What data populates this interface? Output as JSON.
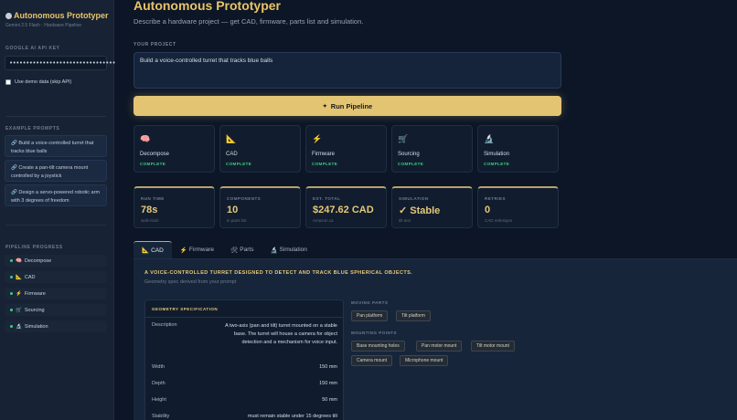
{
  "app": {
    "title": "Autonomous Prototyper",
    "subtitle": "Gemini 2.5 Flash · Hardware Pipeline"
  },
  "sidebar": {
    "api_key_label": "GOOGLE AI API KEY",
    "api_key_value": "••••••••••••••••••••••••••••••••",
    "demo_label": "Use demo data (skip API)",
    "examples_label": "EXAMPLE PROMPTS",
    "examples": [
      "🔗 Build a voice-controlled turret that tracks blue balls",
      "🔗 Create a pan-tilt camera mount controlled by a joystick",
      "🔗 Design a servo-powered robotic arm with 3 degrees of freedom"
    ],
    "progress_label": "PIPELINE PROGRESS",
    "progress": [
      {
        "icon": "🧠",
        "label": "Decompose"
      },
      {
        "icon": "📐",
        "label": "CAD"
      },
      {
        "icon": "⚡",
        "label": "Firmware"
      },
      {
        "icon": "🛒",
        "label": "Sourcing"
      },
      {
        "icon": "🔬",
        "label": "Simulation"
      }
    ]
  },
  "main": {
    "title": "Autonomous Prototyper",
    "subtitle": "Describe a hardware project — get CAD, firmware, parts list and simulation.",
    "project_label": "YOUR PROJECT",
    "project_value": "Build a voice-controlled turret that tracks blue balls",
    "run_label": "Run Pipeline",
    "stages": [
      {
        "icon": "🧠",
        "name": "Decompose",
        "status": "COMPLETE"
      },
      {
        "icon": "📐",
        "name": "CAD",
        "status": "COMPLETE"
      },
      {
        "icon": "⚡",
        "name": "Firmware",
        "status": "COMPLETE"
      },
      {
        "icon": "🛒",
        "name": "Sourcing",
        "status": "COMPLETE"
      },
      {
        "icon": "🔬",
        "name": "Simulation",
        "status": "COMPLETE"
      }
    ],
    "metrics": [
      {
        "label": "RUN TIME",
        "value": "78s",
        "sub": "wall-clock"
      },
      {
        "label": "COMPONENTS",
        "value": "10",
        "sub": "in parts list"
      },
      {
        "label": "EST. TOTAL",
        "value": "$247.62 CAD",
        "sub": "Amazon.ca"
      },
      {
        "label": "SIMULATION",
        "value": "✓ Stable",
        "sub": "tilt test"
      },
      {
        "label": "RETRIES",
        "value": "0",
        "sub": "CAD redesigns"
      }
    ],
    "tabs": [
      {
        "icon": "📐",
        "label": "CAD"
      },
      {
        "icon": "⚡",
        "label": "Firmware"
      },
      {
        "icon": "🛠",
        "label": "Parts"
      },
      {
        "icon": "🔬",
        "label": "Simulation"
      }
    ],
    "cad": {
      "heading": "A VOICE-CONTROLLED TURRET DESIGNED TO DETECT AND TRACK BLUE SPHERICAL OBJECTS.",
      "subheading": "Geometry spec derived from your prompt",
      "spec_title": "GEOMETRY SPECIFICATION",
      "spec": [
        {
          "key": "Description",
          "value": "A two-axis (pan and tilt) turret mounted on a stable base. The turret will house a camera for object detection and a mechanism for voice input."
        },
        {
          "key": "Width",
          "value": "150 mm"
        },
        {
          "key": "Depth",
          "value": "150 mm"
        },
        {
          "key": "Height",
          "value": "50 mm"
        },
        {
          "key": "Stability",
          "value": "must remain stable under 15 degrees tilt"
        }
      ],
      "moving_label": "MOVING PARTS",
      "moving_parts": [
        "Pan platform",
        "Tilt platform"
      ],
      "mounting_label": "MOUNTING POINTS",
      "mounting_points": [
        "Base mounting holes",
        "Pan motor mount",
        "Tilt motor mount",
        "Camera mount",
        "Microphone mount"
      ]
    }
  }
}
